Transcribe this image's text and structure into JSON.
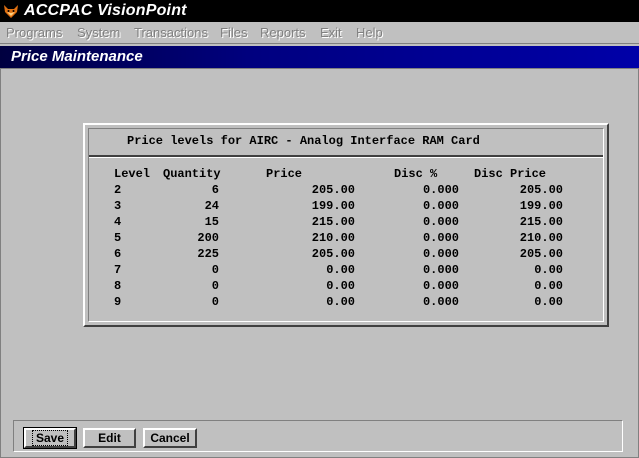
{
  "app": {
    "title": "ACCPAC VisionPoint",
    "icon": "fox-logo-icon"
  },
  "menu": [
    {
      "label": "Programs"
    },
    {
      "label": "System"
    },
    {
      "label": "Transactions"
    },
    {
      "label": "Files"
    },
    {
      "label": "Reports"
    },
    {
      "label": "Exit"
    },
    {
      "label": "Help"
    }
  ],
  "form": {
    "title": "Price Maintenance"
  },
  "panel": {
    "heading": "Price levels for AIRC - Analog Interface RAM Card",
    "columns": [
      "Level",
      "Quantity",
      "Price",
      "Disc %",
      "Disc Price"
    ],
    "rows": [
      {
        "level": "2",
        "quantity": "6",
        "price": "205.00",
        "disc_pct": "0.000",
        "disc_price": "205.00"
      },
      {
        "level": "3",
        "quantity": "24",
        "price": "199.00",
        "disc_pct": "0.000",
        "disc_price": "199.00"
      },
      {
        "level": "4",
        "quantity": "15",
        "price": "215.00",
        "disc_pct": "0.000",
        "disc_price": "215.00"
      },
      {
        "level": "5",
        "quantity": "200",
        "price": "210.00",
        "disc_pct": "0.000",
        "disc_price": "210.00"
      },
      {
        "level": "6",
        "quantity": "225",
        "price": "205.00",
        "disc_pct": "0.000",
        "disc_price": "205.00"
      },
      {
        "level": "7",
        "quantity": "0",
        "price": "0.00",
        "disc_pct": "0.000",
        "disc_price": "0.00"
      },
      {
        "level": "8",
        "quantity": "0",
        "price": "0.00",
        "disc_pct": "0.000",
        "disc_price": "0.00"
      },
      {
        "level": "9",
        "quantity": "0",
        "price": "0.00",
        "disc_pct": "0.000",
        "disc_price": "0.00"
      }
    ]
  },
  "buttons": {
    "save": "Save",
    "edit": "Edit",
    "cancel": "Cancel"
  }
}
